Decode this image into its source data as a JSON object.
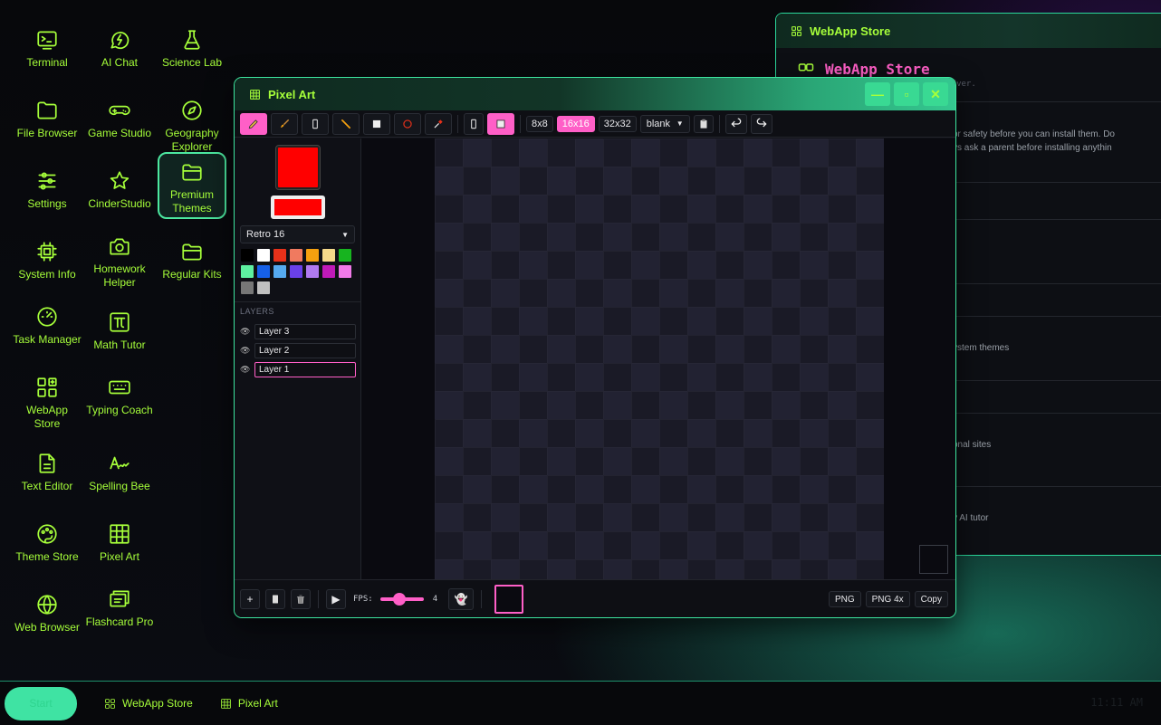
{
  "desktop": {
    "icons": [
      {
        "label": "Terminal",
        "icon": "terminal-icon"
      },
      {
        "label": "AI Chat",
        "icon": "chat-bolt-icon"
      },
      {
        "label": "Science Lab",
        "icon": "flask-icon"
      },
      {
        "label": "File Browser",
        "icon": "folder-icon"
      },
      {
        "label": "Game Studio",
        "icon": "gamepad-icon"
      },
      {
        "label": "Geography Explorer",
        "icon": "compass-icon"
      },
      {
        "label": "Settings",
        "icon": "sliders-icon"
      },
      {
        "label": "CinderStudio",
        "icon": "star-icon"
      },
      {
        "label": "Premium Themes",
        "icon": "folder-open-icon"
      },
      {
        "label": "System Info",
        "icon": "chip-icon"
      },
      {
        "label": "Homework Helper",
        "icon": "camera-icon"
      },
      {
        "label": "Regular Kits",
        "icon": "folder-open-icon"
      },
      {
        "label": "Task Manager",
        "icon": "gauge-icon"
      },
      {
        "label": "Math Tutor",
        "icon": "pi-icon"
      },
      {
        "label": "WebApp Store",
        "icon": "apps-icon"
      },
      {
        "label": "Typing Coach",
        "icon": "keyboard-icon"
      },
      {
        "label": "Text Editor",
        "icon": "document-icon"
      },
      {
        "label": "Spelling Bee",
        "icon": "signature-icon"
      },
      {
        "label": "Theme Store",
        "icon": "palette-icon"
      },
      {
        "label": "Pixel Art",
        "icon": "grid-icon"
      },
      {
        "label": "Web Browser",
        "icon": "globe-icon"
      },
      {
        "label": "Flashcard Pro",
        "icon": "cards-icon"
      }
    ]
  },
  "store_window": {
    "title": "WebApp Store",
    "heading": "WebApp Store",
    "subtitle": "ed. Ever.",
    "lines": [
      "or safety before you can install them. Do",
      "ys ask a parent before installing anythin",
      "ystem themes",
      "onal sites",
      "y AI tutor"
    ]
  },
  "pixel_art": {
    "title": "Pixel Art",
    "toolbar": {
      "sizes": [
        "8x8",
        "16x16",
        "32x32"
      ],
      "active_size": "16x16",
      "template": "blank"
    },
    "primary_color": "#ff0000",
    "secondary_color": "#ff0000",
    "palette_name": "Retro 16",
    "palette": [
      "#000000",
      "#ffffff",
      "#e8311a",
      "#f07a5f",
      "#f5a00f",
      "#f5d98a",
      "#17b41f",
      "#5ef0a0",
      "#1660e8",
      "#55aaf0",
      "#6a40e8",
      "#b07af0",
      "#c01ab8",
      "#f07ae8",
      "#777777",
      "#c0c0c0"
    ],
    "layers_header": "LAYERS",
    "layers": [
      "Layer 3",
      "Layer 2",
      "Layer 1"
    ],
    "active_layer": "Layer 1",
    "fps_label": "FPS:",
    "fps_value": "4",
    "exports": [
      "PNG",
      "PNG 4x",
      "Copy"
    ]
  },
  "taskbar": {
    "start_label": "Start",
    "items": [
      "WebApp Store",
      "Pixel Art"
    ],
    "clock": "11:11 AM"
  }
}
